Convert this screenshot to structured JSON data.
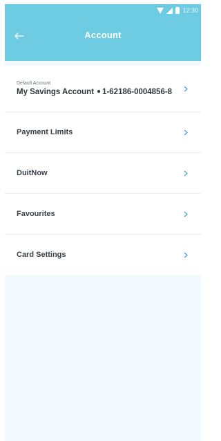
{
  "status_bar": {
    "time": "12:30"
  },
  "header": {
    "title": "Account"
  },
  "default_account": {
    "caption": "Default Account",
    "name": "My Savings Account",
    "number": "1-62186-0004856-8"
  },
  "menu": [
    {
      "label": "Payment Limits"
    },
    {
      "label": "DuitNow"
    },
    {
      "label": "Favourites"
    },
    {
      "label": "Card Settings"
    }
  ],
  "colors": {
    "header": "#6dcbe2",
    "background": "#f3fafd",
    "chevron": "#3ba9c8"
  }
}
